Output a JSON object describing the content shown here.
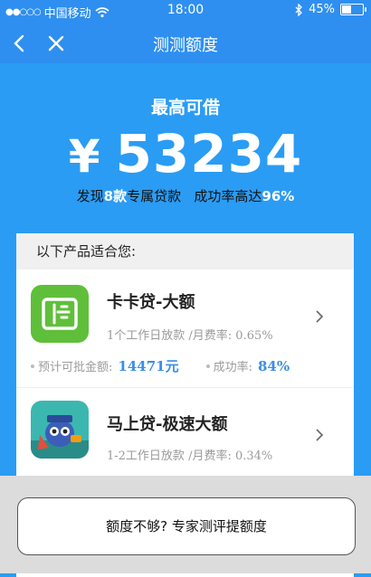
{
  "status_bar": {
    "carrier": "中国移动",
    "time": "18:00",
    "battery": "45%",
    "battery_level": 0.45
  },
  "nav": {
    "title": "测测额度",
    "back_icon": "chevron-left-icon",
    "close_icon": "close-icon"
  },
  "hero": {
    "label": "最高可借",
    "currency": "¥",
    "amount": "53234",
    "subline_prefix": "发现",
    "subline_count": "8款",
    "subline_mid": "专属贷款   成功率高达",
    "subline_rate": "96%"
  },
  "list": {
    "header": "以下产品适合您:",
    "products": [
      {
        "name": "卡卡贷-大额",
        "desc": "1个工作日放款 /月费率: 0.65%",
        "approve_label": "预计可批金额:",
        "approve_value": "14471元",
        "success_label": "成功率:",
        "success_value": "84%",
        "icon": "kakadai-logo-icon",
        "icon_color": "#5fbf3a"
      },
      {
        "name": "马上贷-极速大额",
        "desc": "1-2工作日放款 /月费率: 0.34%",
        "icon": "mascot-logo-icon",
        "icon_color": "#3bb7b0"
      }
    ]
  },
  "footer": {
    "button_label": "额度不够? 专家测评提额度"
  },
  "colors": {
    "primary": "#2e8ff0",
    "accent_value": "#3a8ee6"
  }
}
